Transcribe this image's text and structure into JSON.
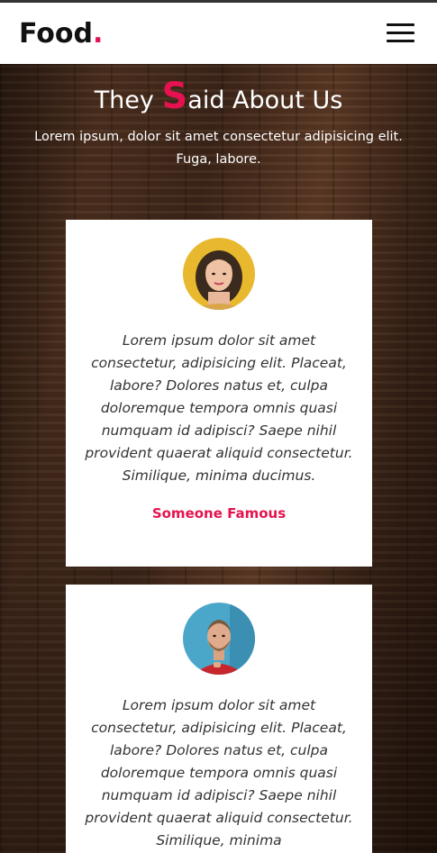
{
  "header": {
    "logo_text": "Food",
    "logo_dot": ".",
    "menu_icon": "hamburger-menu-icon"
  },
  "section": {
    "title_pre": "They ",
    "title_initial": "S",
    "title_rest": "aid About Us",
    "subtitle": "Lorem ipsum, dolor sit amet consectetur adipisicing elit. Fuga, labore."
  },
  "testimonials": [
    {
      "avatar": "woman-avatar-yellow-background",
      "quote": "Lorem ipsum dolor sit amet consectetur, adipisicing elit. Placeat, labore? Dolores natus et, culpa doloremque tempora omnis quasi numquam id adipisci? Saepe nihil provident quaerat aliquid consectetur. Similique, minima ducimus.",
      "name": "Someone Famous"
    },
    {
      "avatar": "man-avatar-blue-background",
      "quote": "Lorem ipsum dolor sit amet consectetur, adipisicing elit. Placeat, labore? Dolores natus et, culpa doloremque tempora omnis quasi numquam id adipisci? Saepe nihil provident quaerat aliquid consectetur. Similique, minima",
      "name": ""
    }
  ],
  "colors": {
    "accent": "#e4134f",
    "header_bg": "#ffffff",
    "text_dark": "#111111"
  }
}
